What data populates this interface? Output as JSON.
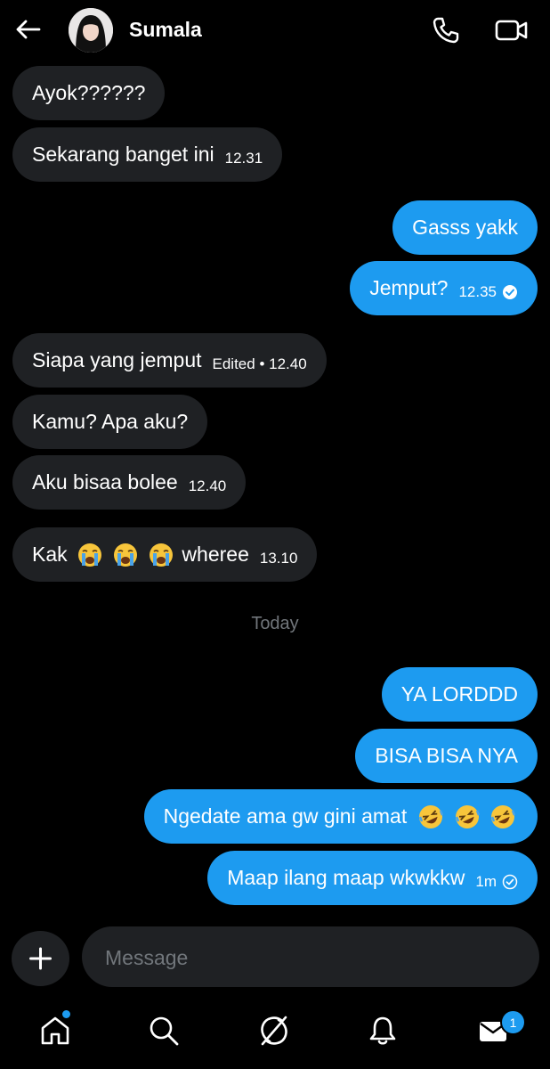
{
  "contact": {
    "name": "Sumala"
  },
  "messages": [
    {
      "text": "Ayok??????",
      "time": ""
    },
    {
      "text": "Sekarang banget ini",
      "time": "12.31"
    },
    {
      "text": "Gasss yakk",
      "time": ""
    },
    {
      "text": "Jemput?",
      "time": "12.35"
    },
    {
      "text": "Siapa yang jemput",
      "time": "Edited • 12.40"
    },
    {
      "text": "Kamu? Apa aku?",
      "time": ""
    },
    {
      "text": "Aku bisaa bolee",
      "time": "12.40"
    },
    {
      "text_before": "Kak",
      "emoji": "crying-emoji",
      "text_after": "wheree",
      "time": "13.10"
    },
    {
      "text": "YA LORDDD",
      "time": ""
    },
    {
      "text": "BISA BISA NYA",
      "time": ""
    },
    {
      "text": "Ngedate ama gw gini amat",
      "emoji": "rofl-emoji",
      "time": ""
    },
    {
      "text": "Maap ilang maap wkwkkw",
      "time": "1m"
    }
  ],
  "divider": {
    "label": "Today"
  },
  "composer": {
    "placeholder": "Message"
  },
  "nav": {
    "messages_badge": "1"
  },
  "colors": {
    "accent": "#1d9bf0",
    "incoming_bubble": "#1f2124",
    "background": "#000000",
    "muted": "#71767b"
  }
}
